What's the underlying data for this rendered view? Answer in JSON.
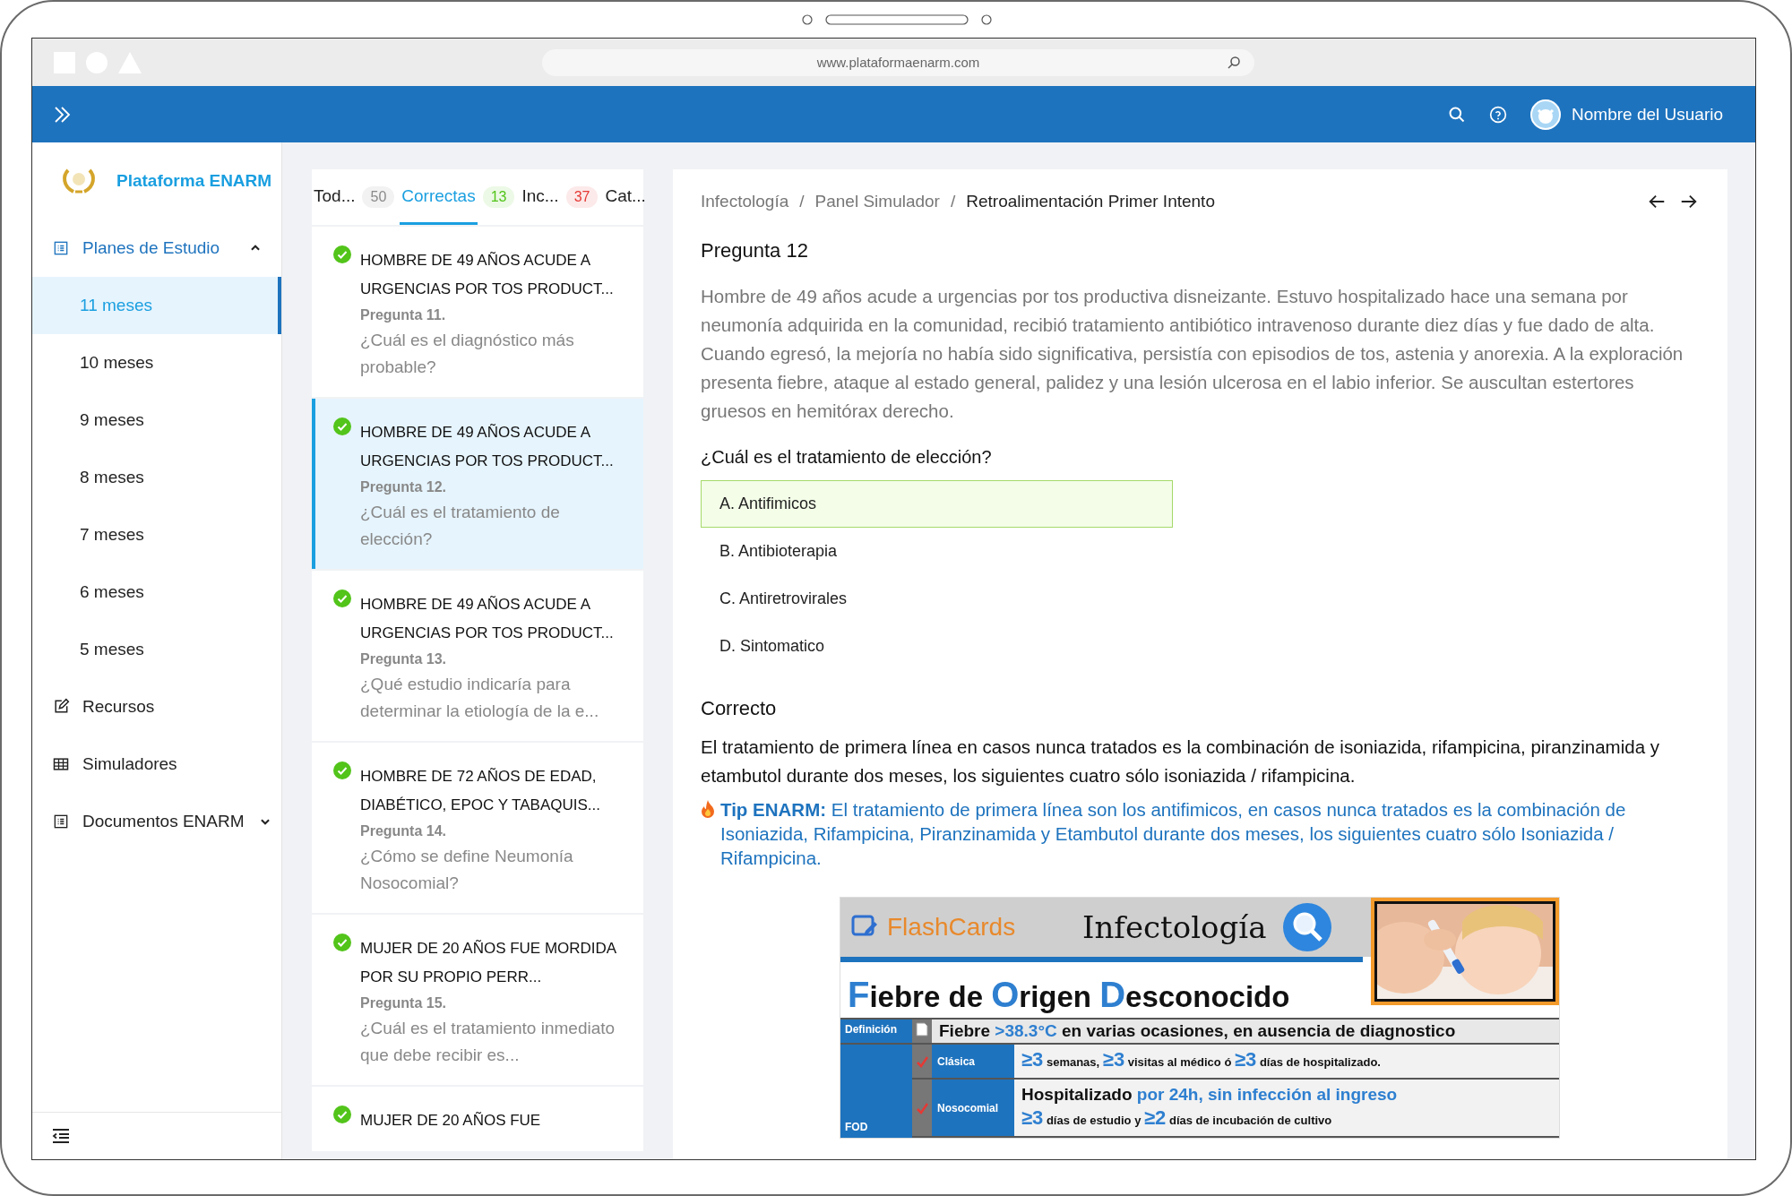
{
  "browser": {
    "url": "www.plataformaenarm.com"
  },
  "header": {
    "user_name": "Nombre del Usuario"
  },
  "sidebar": {
    "brand": "Plataforma ENARM",
    "items": [
      {
        "label": "Planes de Estudio",
        "expanded": true,
        "children": [
          {
            "label": "11 meses",
            "selected": true
          },
          {
            "label": "10 meses",
            "selected": false
          },
          {
            "label": "9 meses",
            "selected": false
          },
          {
            "label": "8 meses",
            "selected": false
          },
          {
            "label": "7 meses",
            "selected": false
          },
          {
            "label": "6 meses",
            "selected": false
          },
          {
            "label": "5 meses",
            "selected": false
          }
        ]
      },
      {
        "label": "Recursos"
      },
      {
        "label": "Simuladores"
      },
      {
        "label": "Documentos ENARM",
        "expanded": false
      }
    ]
  },
  "tabs": [
    {
      "label": "Tod...",
      "count": "50",
      "color": "#8a8a8a",
      "selected": false
    },
    {
      "label": "Correctas",
      "count": "13",
      "color": "#52c41a",
      "selected": true
    },
    {
      "label": "Inc...",
      "count": "37",
      "color": "#e53935",
      "selected": false
    },
    {
      "label": "Cat...",
      "selected": false
    }
  ],
  "questions": [
    {
      "title": "HOMBRE DE 49 AÑOS ACUDE A URGENCIAS POR TOS PRODUCT...",
      "number": "Pregunta 11.",
      "question": "¿Cuál es el diagnóstico más probable?",
      "correct": true,
      "selected": false
    },
    {
      "title": "HOMBRE DE 49 AÑOS ACUDE A URGENCIAS POR TOS PRODUCT...",
      "number": "Pregunta 12.",
      "question": "¿Cuál es el tratamiento de elección?",
      "correct": true,
      "selected": true
    },
    {
      "title": "HOMBRE DE 49 AÑOS ACUDE A URGENCIAS POR TOS PRODUCT...",
      "number": "Pregunta 13.",
      "question": "¿Qué estudio indicaría para determinar la etiología de la e...",
      "correct": true,
      "selected": false
    },
    {
      "title": "HOMBRE DE 72 AÑOS DE EDAD, DIABÉTICO, EPOC Y TABAQUIS...",
      "number": "Pregunta 14.",
      "question": "¿Cómo se define Neumonía Nosocomial?",
      "correct": true,
      "selected": false
    },
    {
      "title": "MUJER DE 20 AÑOS FUE MORDIDA POR SU PROPIO PERR...",
      "number": "Pregunta 15.",
      "question": "¿Cuál es el tratamiento inmediato que debe recibir es...",
      "correct": true,
      "selected": false
    },
    {
      "title": "MUJER DE 20 AÑOS FUE",
      "correct": true,
      "selected": false
    }
  ],
  "detail": {
    "breadcrumb_separator": "/",
    "breadcrumb": [
      "Infectología",
      "Panel Simulador",
      "Retroalimentación Primer Intento"
    ],
    "title": "Pregunta 12",
    "stem": "Hombre de 49 años acude a urgencias por tos productiva disneizante. Estuvo hospitalizado hace una semana por neumonía adquirida en la comunidad, recibió tratamiento antibiótico intravenoso durante diez días y fue dado de alta. Cuando egresó, la mejoría no había sido significativa, persistía con episodios de tos, astenia y anorexia. A la exploración presenta fiebre, ataque al estado general, palidez y una lesión ulcerosa en el labio inferior. Se auscultan estertores gruesos en hemitórax derecho.",
    "prompt": "¿Cuál es el tratamiento de elección?",
    "options": [
      {
        "label": "A. Antifimicos",
        "correct": true
      },
      {
        "label": "B. Antibioterapia",
        "correct": false
      },
      {
        "label": "C. Antiretrovirales",
        "correct": false
      },
      {
        "label": "D. Sintomatico",
        "correct": false
      }
    ],
    "result": "Correcto",
    "explanation": "El tratamiento de primera línea en casos nunca tratados es la combinación de isoniazida, rifampicina, piranzinamida y etambutol durante dos meses, los siguientes cuatro sólo isoniazida / rifampicina.",
    "tip": "**Tip ENARM:**  El tratamiento de primera línea son los antifimicos, en casos nunca tratados es la combinación de Isoniazida, Rifampicina, Piranzinamida y Etambutol durante dos meses, los siguientes cuatro sólo Isoniazida / Rifampicina.",
    "flashcard": {
      "brand": "FlashCards",
      "subject": "Infectología",
      "title": "**F**iebre de **O**rigen **D**esconocido",
      "definition": {
        "label": "Definición",
        "text": "Fiebre **>38.3°C** en varias ocasiones,  en ausencia de diagnostico"
      },
      "group": "FOD",
      "rows": [
        {
          "label": "Clásica",
          "lines": [
            "**≥3** semanas, **≥3** visitas al médico ó **≥3** días de hospitalizado."
          ]
        },
        {
          "label": "Nosocomial",
          "lines": [
            "Hospitalizado **por 24h, sin infección al ingreso**",
            "**≥3** días de estudio y **≥2** días de incubación de cultivo"
          ]
        }
      ]
    }
  }
}
